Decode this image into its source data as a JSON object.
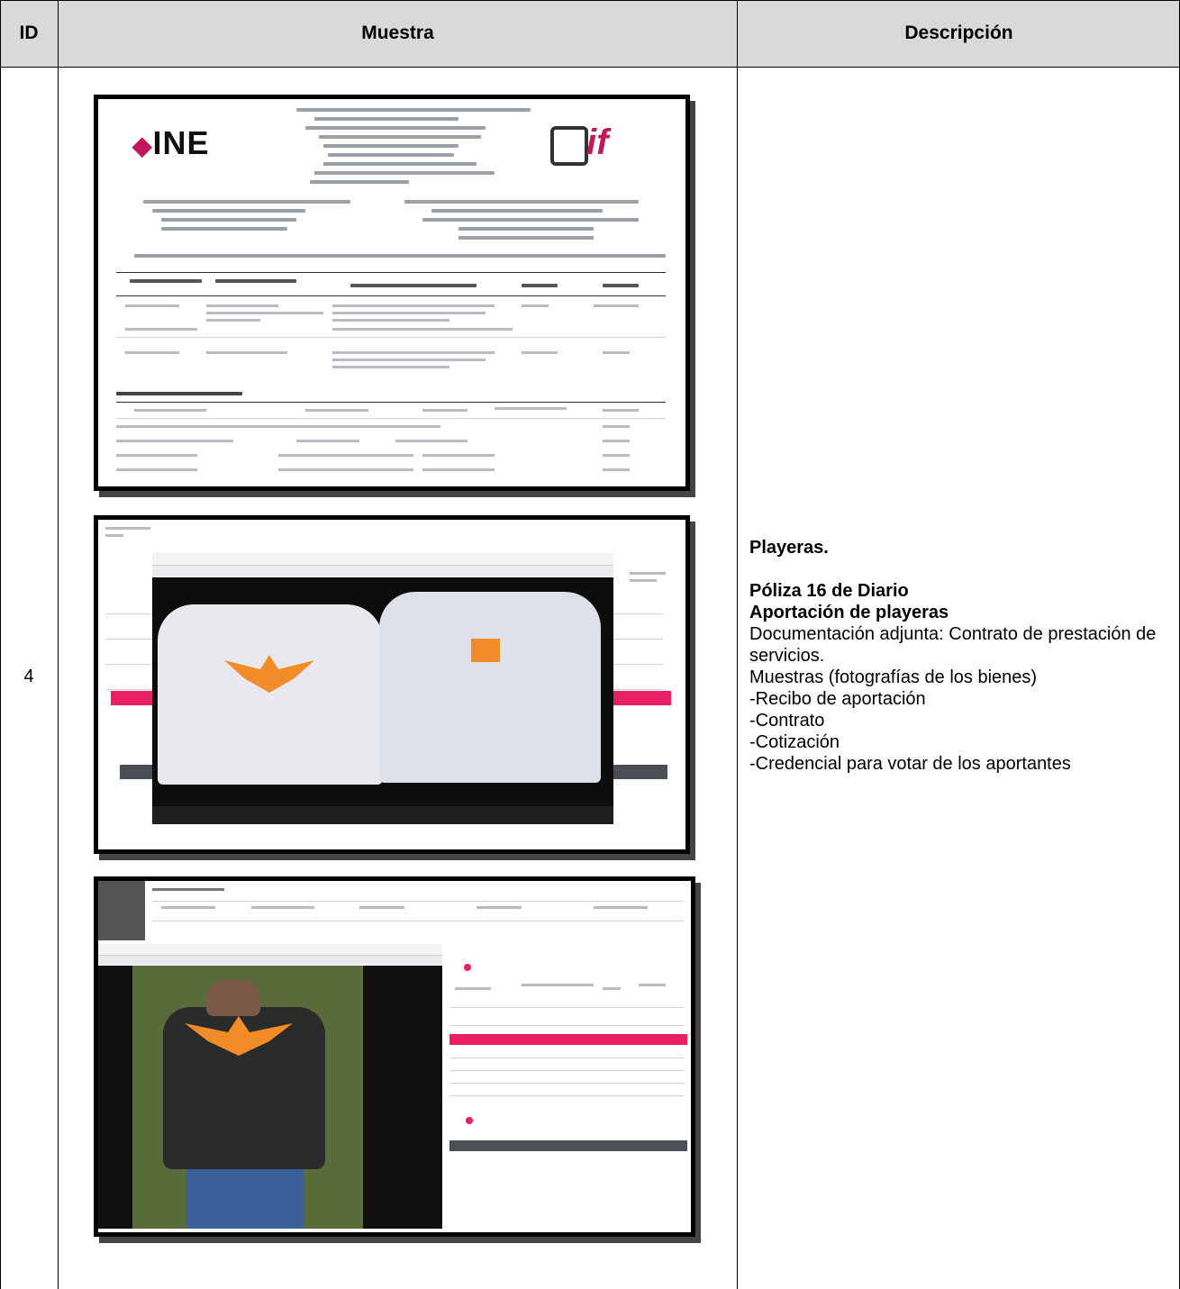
{
  "table": {
    "headers": {
      "id": "ID",
      "sample": "Muestra",
      "description": "Descripción"
    },
    "row": {
      "id": "4",
      "description": {
        "title": "Playeras.",
        "policy": "Póliza 16 de Diario",
        "subject": "Aportación de playeras",
        "lines": [
          "Documentación adjunta: Contrato de prestación de servicios.",
          "Muestras (fotografías de los bienes)",
          "-Recibo de aportación",
          "-Contrato",
          "-Cotización",
          "-Credencial para votar de los aportantes"
        ]
      }
    }
  },
  "screenshot1": {
    "logo_left": "INE",
    "logo_right": "if"
  },
  "colors": {
    "header_bg": "#d9d9d9",
    "accent": "#e91e63",
    "logo_orange": "#f28c28"
  }
}
